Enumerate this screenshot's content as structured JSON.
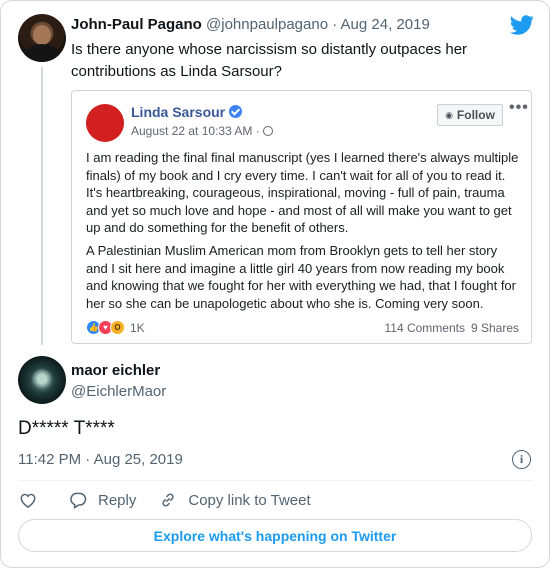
{
  "parent_tweet": {
    "name": "John-Paul Pagano",
    "handle": "@johnpaulpagano",
    "separator": "·",
    "date": "Aug 24, 2019",
    "text": "Is there anyone whose narcissism so distantly outpaces her contributions as Linda Sarsour?"
  },
  "embedded_post": {
    "author": "Linda Sarsour",
    "date": "August 22 at 10:33 AM · ",
    "follow_label": "Follow",
    "more_label": "•••",
    "paragraph_1": "I am reading the final final manuscript (yes I learned there's always multiple finals) of my book and I cry every time. I can't wait for all of you to read it. It's heartbreaking, courageous, inspirational, moving - full of pain, trauma and yet so much love and hope - and most of all will make you want to get up and do something for the benefit of others.",
    "paragraph_2": "A Palestinian Muslim American mom from Brooklyn gets to tell her story and I sit here and imagine a little girl 40 years from now reading my book and knowing that we fought for her with everything we had, that I fought for her so she can be unapologetic about who she is. Coming very soon.",
    "reactions_count": "1K",
    "comments": "114 Comments",
    "shares": "9 Shares",
    "reaction_icons": [
      "like-icon",
      "love-icon",
      "wow-icon"
    ]
  },
  "reply_tweet": {
    "name": "maor eichler",
    "handle": "@EichlerMaor",
    "text": "D***** T****",
    "timestamp": "11:42 PM · Aug 25, 2019"
  },
  "actions": {
    "reply_label": "Reply",
    "copy_link_label": "Copy link to Tweet"
  },
  "explore_label": "Explore what's happening on Twitter",
  "colors": {
    "twitter_blue": "#1d9bf0",
    "facebook_link": "#385898",
    "muted_text": "#536471"
  }
}
